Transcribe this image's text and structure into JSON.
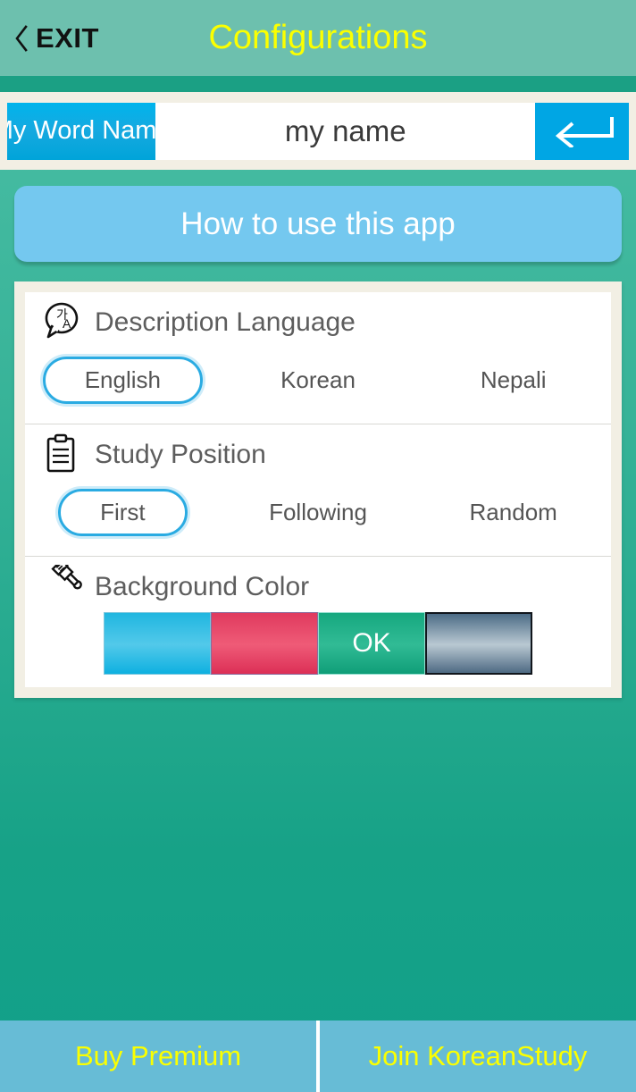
{
  "header": {
    "exit_label": "EXIT",
    "back_icon": "chevron-left-icon",
    "title": "Configurations",
    "title_color": "#fbff00",
    "bg_color": "#6dc0ae"
  },
  "name_row": {
    "tag_label": "My Word Name",
    "input_value": "my name",
    "input_placeholder": "my name",
    "submit_icon": "enter-return-arrow-icon",
    "tag_color": "#00a9e0",
    "submit_color": "#00a6e4"
  },
  "howto": {
    "label": "How to use this app",
    "color": "#74c8ef"
  },
  "settings": {
    "sections": [
      {
        "icon": "translate-speech-bubble-icon",
        "title": "Description Language",
        "options": [
          "English",
          "Korean",
          "Nepali"
        ],
        "selected": 0
      },
      {
        "icon": "clipboard-icon",
        "title": "Study Position",
        "options": [
          "First",
          "Following",
          "Random"
        ],
        "selected": 0
      }
    ],
    "background_color_section": {
      "icon": "paintbrush-icon",
      "title": "Background Color",
      "selected_label": "OK",
      "selected": 2,
      "swatches": [
        "#29bce6",
        "#e5415f",
        "#19ae86",
        "#7e98ac"
      ]
    }
  },
  "bottom_bar": {
    "buy_premium": "Buy Premium",
    "join_koreanstudy": "Join KoreanStudy",
    "text_color": "#fbff00",
    "bg_color": "#67bcd6"
  }
}
